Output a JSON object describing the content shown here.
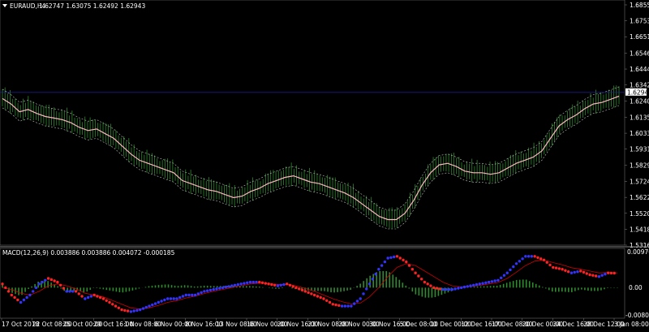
{
  "main_window": {
    "symbol_label": "EURAUD,H4",
    "ohlc": "1.62747 1.63075 1.62492 1.62943",
    "current_price": "1.62943",
    "price_scale": [
      "1.68550",
      "1.67530",
      "1.66510",
      "1.65460",
      "1.64440",
      "1.63420",
      "1.62400",
      "1.61350",
      "1.60330",
      "1.59310",
      "1.58290",
      "1.57240",
      "1.56220",
      "1.55200",
      "1.54180",
      "1.53160"
    ]
  },
  "macd_window": {
    "label": "MACD(12,26,9) 0.003886 0.003886 0.004072 -0.000185",
    "scale": [
      "0.009768",
      "0.00",
      "-0.008065"
    ]
  },
  "time_axis": [
    "17 Oct 2018",
    "22 Oct 08:00",
    "25 Oct 00:00",
    "29 Oct 16:00",
    "1 Nov 08:00",
    "6 Nov 00:00",
    "8 Nov 16:00",
    "13 Nov 08:00",
    "16 Nov 00:00",
    "20 Nov 16:00",
    "23 Nov 08:00",
    "28 Nov 00:00",
    "30 Nov 16:00",
    "5 Dec 08:00",
    "10 Dec 00:00",
    "12 Dec 16:00",
    "17 Dec 08:00",
    "20 Dec 00:00",
    "24 Dec 16:00",
    "28 Dec 12:00",
    "3 Jan 08:00"
  ],
  "colors": {
    "background": "#000000",
    "grid_text": "#ffffff",
    "price_line": "#000080",
    "ma_line": "#ffb6c1",
    "bands": "#c0c0c0",
    "candles": "#2e8b2e",
    "macd_up": "#3333ff",
    "macd_down": "#ff2222",
    "signal": "#cc0000",
    "histogram": "#2e8b2e"
  },
  "chart_data": [
    {
      "type": "line",
      "name_ref": "main_window.symbol_label",
      "x_categories_ref": "time_axis",
      "price_range": [
        1.5316,
        1.6855
      ],
      "series_values": [
        1.6255,
        1.622,
        1.617,
        1.6185,
        1.616,
        1.614,
        1.613,
        1.612,
        1.61,
        1.607,
        1.605,
        1.606,
        1.603,
        1.6,
        1.595,
        1.59,
        1.586,
        1.584,
        1.582,
        1.58,
        1.578,
        1.573,
        1.571,
        1.569,
        1.567,
        1.566,
        1.564,
        1.562,
        1.563,
        1.566,
        1.568,
        1.571,
        1.573,
        1.575,
        1.576,
        1.574,
        1.572,
        1.571,
        1.569,
        1.567,
        1.565,
        1.562,
        1.558,
        1.554,
        1.55,
        1.548,
        1.548,
        1.552,
        1.56,
        1.57,
        1.578,
        1.583,
        1.584,
        1.582,
        1.579,
        1.578,
        1.578,
        1.577,
        1.578,
        1.581,
        1.584,
        1.586,
        1.588,
        1.592,
        1.6,
        1.608,
        1.612,
        1.615,
        1.619,
        1.622,
        1.623,
        1.625,
        1.627
      ],
      "current_price": 1.62943,
      "band_offset": 0.006
    },
    {
      "type": "line",
      "name_ref": "macd_window.label",
      "y_range": [
        -0.008065,
        0.009768
      ],
      "macd_values": [
        0.001,
        -0.002,
        -0.004,
        -0.002,
        0.001,
        0.0025,
        0.0015,
        -0.001,
        -0.001,
        -0.003,
        -0.002,
        -0.003,
        -0.0045,
        -0.006,
        -0.0065,
        -0.006,
        -0.005,
        -0.004,
        -0.003,
        -0.003,
        -0.002,
        -0.002,
        -0.001,
        -0.0005,
        0,
        0.0005,
        0.001,
        0.0015,
        0.0015,
        0.001,
        0.0005,
        0.001,
        0,
        -0.001,
        -0.002,
        -0.003,
        -0.0045,
        -0.005,
        -0.005,
        -0.003,
        0.001,
        0.005,
        0.008,
        0.0085,
        0.007,
        0.004,
        0.0015,
        0,
        -0.0005,
        -0.0005,
        0,
        0.0005,
        0.001,
        0.0015,
        0.002,
        0.004,
        0.0065,
        0.0085,
        0.0085,
        0.0075,
        0.0055,
        0.005,
        0.004,
        0.0045,
        0.0035,
        0.003,
        0.004,
        0.0039
      ],
      "signal_values": [
        0,
        -0.0005,
        -0.0015,
        -0.002,
        -0.001,
        0.0005,
        0.001,
        0.0005,
        -0.0003,
        -0.0015,
        -0.002,
        -0.0025,
        -0.0035,
        -0.0045,
        -0.0055,
        -0.0058,
        -0.0055,
        -0.0048,
        -0.004,
        -0.0035,
        -0.0028,
        -0.0023,
        -0.0016,
        -0.001,
        -0.0005,
        0,
        0.0005,
        0.001,
        0.0012,
        0.0011,
        0.0009,
        0.0009,
        0.0005,
        -0.0002,
        -0.001,
        -0.002,
        -0.003,
        -0.0038,
        -0.0044,
        -0.0042,
        -0.0025,
        0,
        0.003,
        0.0055,
        0.0065,
        0.006,
        0.0045,
        0.003,
        0.0015,
        0.0005,
        0.0002,
        0.0003,
        0.0006,
        0.001,
        0.0014,
        0.0025,
        0.0042,
        0.006,
        0.0072,
        0.0075,
        0.0068,
        0.0062,
        0.0054,
        0.005,
        0.0045,
        0.004,
        0.0041,
        0.004
      ]
    }
  ]
}
